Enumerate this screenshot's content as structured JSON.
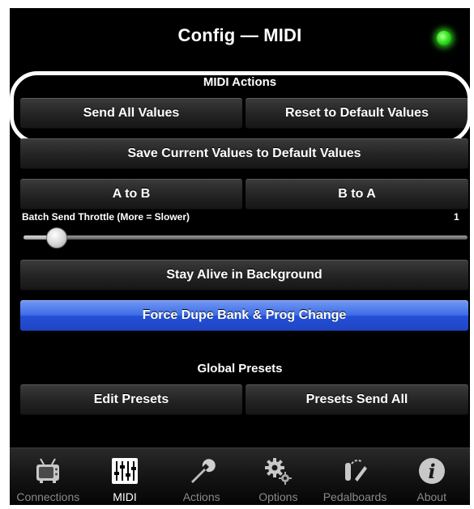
{
  "header": {
    "title": "Config — MIDI",
    "status_color": "#34e81f"
  },
  "midi_actions": {
    "heading": "MIDI Actions",
    "send_all": "Send All Values",
    "reset_default": "Reset to Default Values"
  },
  "save_current": "Save Current Values to Default Values",
  "a_to_b": "A to B",
  "b_to_a": "B to A",
  "throttle": {
    "label": "Batch Send Throttle (More = Slower)",
    "value": "1"
  },
  "stay_alive": "Stay Alive in Background",
  "force_dupe": "Force Dupe Bank & Prog Change",
  "global_presets": {
    "heading": "Global Presets",
    "edit": "Edit Presets",
    "send_all": "Presets Send All"
  },
  "tabs": [
    {
      "label": "Connections",
      "icon": "tv-icon",
      "active": false
    },
    {
      "label": "MIDI",
      "icon": "sliders-icon",
      "active": true
    },
    {
      "label": "Actions",
      "icon": "wrench-icon",
      "active": false
    },
    {
      "label": "Options",
      "icon": "gear-icon",
      "active": false
    },
    {
      "label": "Pedalboards",
      "icon": "pedalboard-icon",
      "active": false
    },
    {
      "label": "About",
      "icon": "info-icon",
      "active": false
    }
  ]
}
